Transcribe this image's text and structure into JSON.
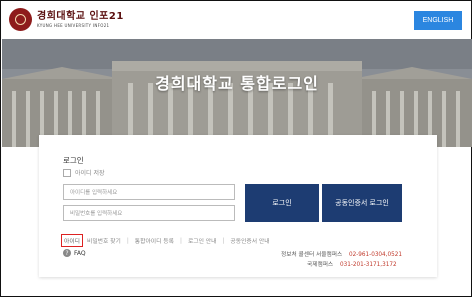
{
  "header": {
    "logo_main": "경희대학교 인포21",
    "logo_sub": "KYUNG HEE UNIVERSITY INFO21",
    "english_button": "ENGLISH"
  },
  "hero": {
    "title": "경희대학교 통합로그인"
  },
  "login": {
    "title": "로그인",
    "save_id_label": "아이디 저장",
    "id_placeholder": "아이디를 입력하세요",
    "pw_placeholder": "비밀번호를 입력하세요",
    "login_button": "로그인",
    "cert_login_button": "공동인증서 로그인"
  },
  "links": {
    "id_find": "아이디",
    "pw_find": "비밀번호 찾기",
    "register": "통합아이디 등록",
    "login_guide": "로그인 안내",
    "cert_guide": "공동인증서 안내",
    "separator": "|"
  },
  "faq": {
    "icon": "?",
    "label": "FAQ"
  },
  "contacts": {
    "seoul_label": "정보처 콜센터 서울캠퍼스",
    "seoul_number": "02-961-0304,0521",
    "global_label": "국제캠퍼스",
    "global_number": "031-201-3171,3172"
  },
  "colors": {
    "accent_blue": "#2b86e0",
    "button_navy": "#1d3c72",
    "brand_maroon": "#8e1b1b",
    "highlight_red": "#dd2222"
  }
}
